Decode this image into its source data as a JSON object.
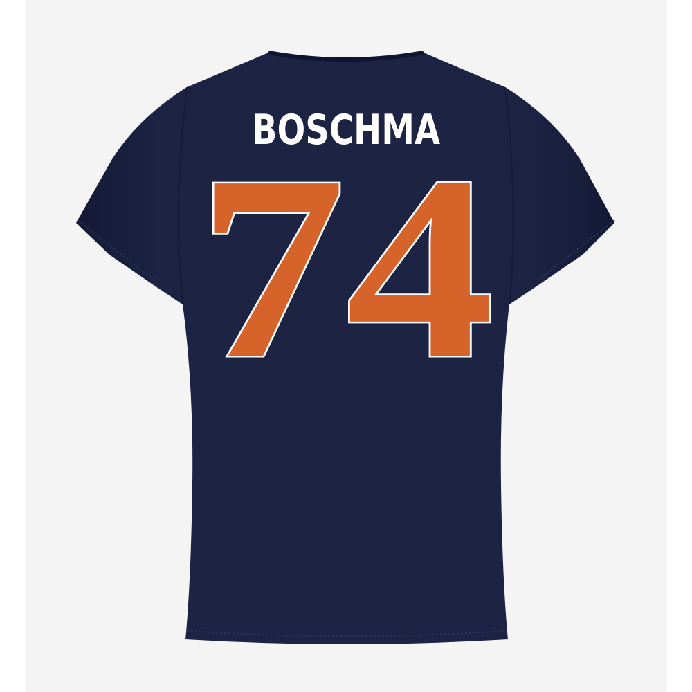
{
  "product": {
    "player_name": "BOSCHMA",
    "player_number": "74",
    "shirt_color": "#1c2343",
    "number_color": "#d5632a",
    "number_outline_color": "#ffffff",
    "name_color": "#ffffff"
  }
}
